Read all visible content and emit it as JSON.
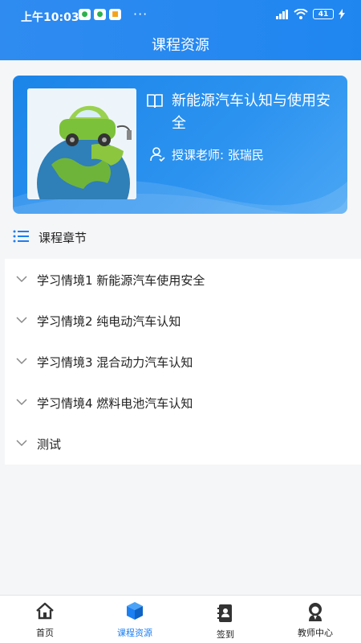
{
  "status_bar": {
    "time": "上午10:03",
    "battery": "41"
  },
  "header": {
    "title": "课程资源"
  },
  "course": {
    "name": "新能源汽车认知与使用安全",
    "teacher": "授课老师: 张瑞民"
  },
  "chapters_section": {
    "title": "课程章节"
  },
  "chapters": [
    "学习情境1 新能源汽车使用安全",
    "学习情境2 纯电动汽车认知",
    "学习情境3 混合动力汽车认知",
    "学习情境4 燃料电池汽车认知",
    "测试"
  ],
  "tabs": [
    {
      "label": "首页",
      "icon": "home-icon"
    },
    {
      "label": "课程资源",
      "icon": "cube-icon"
    },
    {
      "label": "签到",
      "icon": "contacts-book-icon"
    },
    {
      "label": "教师中心",
      "icon": "teacher-icon"
    }
  ],
  "colors": {
    "accent": "#1c7ff2",
    "header": "#2f8bf0"
  }
}
